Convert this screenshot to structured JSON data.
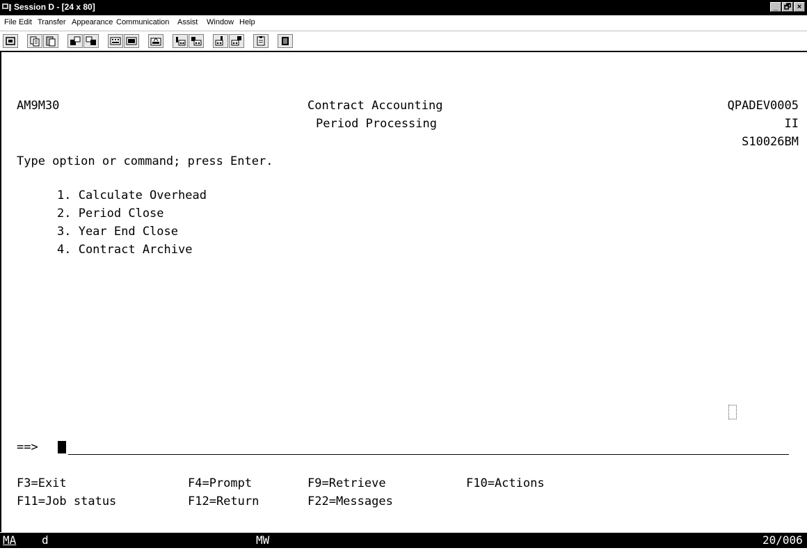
{
  "window": {
    "title": "Session D - [24 x 80]",
    "controls": [
      "_",
      "🗗",
      "×"
    ]
  },
  "menu": [
    "File",
    "Edit",
    "Transfer",
    "Appearance",
    "Communication",
    "Assist",
    "Window",
    "Help"
  ],
  "toolbar": {
    "icons": [
      "print-screen-icon",
      "copy-icon",
      "paste-icon",
      "send-file-icon",
      "receive-file-icon",
      "keypad-icon",
      "display-icon",
      "macro-icon",
      "record-icon",
      "play-icon",
      "start-macro-icon",
      "stop-macro-icon",
      "clipboard-icon",
      "close-session-icon"
    ]
  },
  "terminal": {
    "program_id": "AM9M30",
    "title_line1": "Contract Accounting",
    "title_line2": "Period Processing",
    "system_name": "QPADEV0005",
    "system_line2": "II",
    "system_line3": "S10026BM",
    "instruction": "Type option or command; press Enter.",
    "options": [
      "1. Calculate Overhead",
      "2. Period Close",
      "3. Year End Close",
      "4. Contract Archive"
    ],
    "command_prompt": "==>",
    "command_value": "",
    "function_keys_row1": [
      "F3=Exit",
      "F4=Prompt",
      "F9=Retrieve",
      "F10=Actions"
    ],
    "function_keys_row2": [
      "F11=Job status",
      "F12=Return",
      "F22=Messages"
    ]
  },
  "status_line": {
    "left": "MA",
    "session_char": "d",
    "mode": "MW",
    "cursor_position": "20/006"
  }
}
